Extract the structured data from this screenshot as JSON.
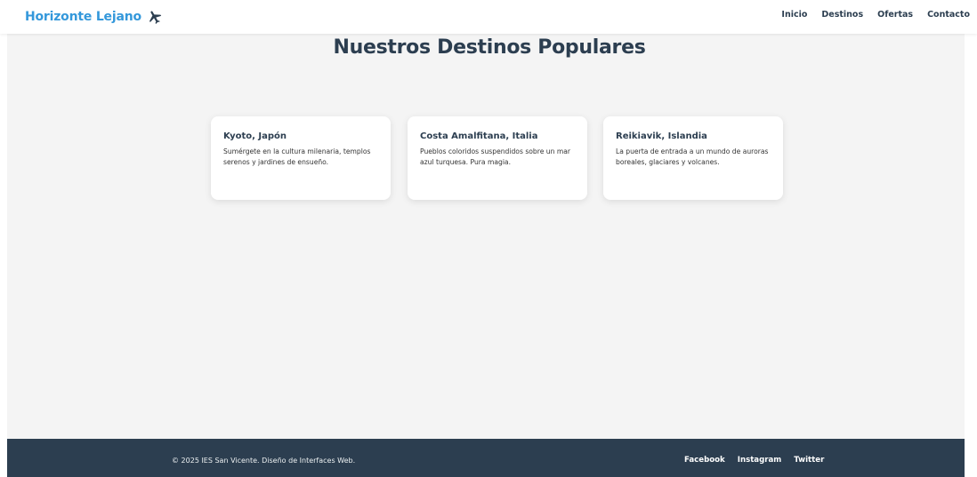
{
  "header": {
    "brand": "Horizonte Lejano",
    "brand_icon": "airplane-icon",
    "nav": [
      {
        "label": "Inicio"
      },
      {
        "label": "Destinos"
      },
      {
        "label": "Ofertas"
      },
      {
        "label": "Contacto"
      }
    ]
  },
  "main": {
    "title": "Nuestros Destinos Populares",
    "cards": [
      {
        "title": "Kyoto, Japón",
        "text": "Sumérgete en la cultura milenaria, templos serenos y jardines de ensueño."
      },
      {
        "title": "Costa Amalfitana, Italia",
        "text": "Pueblos coloridos suspendidos sobre un mar azul turquesa. Pura magia."
      },
      {
        "title": "Reikiavik, Islandia",
        "text": "La puerta de entrada a un mundo de auroras boreales, glaciares y volcanes."
      }
    ]
  },
  "footer": {
    "copyright": "© 2025 IES San Vicente. Diseño de Interfaces Web.",
    "links": [
      {
        "label": "Facebook"
      },
      {
        "label": "Instagram"
      },
      {
        "label": "Twitter"
      }
    ]
  },
  "colors": {
    "brand": "#3498db",
    "dark": "#2c3e50",
    "background": "#f4f4f4",
    "card": "#ffffff"
  }
}
